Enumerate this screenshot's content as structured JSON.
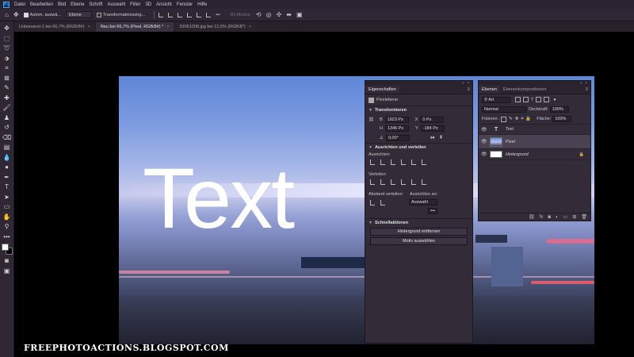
{
  "menu": {
    "logo": "Ps",
    "items": [
      "Datei",
      "Bearbeiten",
      "Bild",
      "Ebene",
      "Schrift",
      "Auswahl",
      "Filter",
      "3D",
      "Ansicht",
      "Fenster",
      "Hilfe"
    ]
  },
  "options": {
    "auto_select_label": "Autom. auswä...",
    "auto_select_value": "Ebene",
    "transform_label": "Transformationsstrg...",
    "mode_3d": "3D-Modus:"
  },
  "tabs": [
    {
      "label": "Unbenannt-1 bei 66,7% (RGB/8#)",
      "close": "×",
      "active": false
    },
    {
      "label": "Neu bei 66,7% (Pixel, RGB/8#) *",
      "close": "×",
      "active": true
    },
    {
      "label": "53061008.jpg bei 12,5% (RGB/8*)",
      "close": "×",
      "active": false
    }
  ],
  "canvas": {
    "text": "Text"
  },
  "watermark": "FREEPHOTOACTIONS.BLOGSPOT.COM",
  "properties": {
    "tab": "Eigenschaften",
    "menu_icon": "≡",
    "layer_type": "Pixelebene",
    "transform": {
      "title": "Transformieren",
      "w_label": "B",
      "w_value": "1923 Px",
      "x_label": "X",
      "x_value": "0 Px",
      "h_label": "H",
      "h_value": "1346 Px",
      "y_label": "Y",
      "y_value": "-184 Px",
      "angle_value": "0,00°"
    },
    "align": {
      "title": "Ausrichten und verteilen",
      "align_label": "Ausrichten:",
      "distribute_label": "Verteilen:",
      "spacing_label": "Abstand verteilen:",
      "align_to_label": "Ausrichten an:",
      "align_to_value": "Auswahl",
      "more": "•••"
    },
    "quick": {
      "title": "Schnellaktionen",
      "remove_bg": "Hintergrund entfernen",
      "select_subject": "Motiv auswählen"
    }
  },
  "layers": {
    "tabs": [
      "Ebenen",
      "Ebenenkompositionen"
    ],
    "menu_icon": "≡",
    "filter_kind": "Art",
    "blend_mode": "Normal",
    "opacity_label": "Deckkraft:",
    "opacity_value": "100%",
    "fixieren_label": "Fixieren:",
    "fill_label": "Fläche:",
    "fill_value": "100%",
    "items": [
      {
        "name": "Text",
        "kind": "text",
        "selected": false,
        "locked": false
      },
      {
        "name": "Pixel",
        "kind": "image",
        "selected": true,
        "locked": false
      },
      {
        "name": "Hintergrund",
        "kind": "white",
        "selected": false,
        "locked": true
      }
    ],
    "bottom_icons": [
      "link-icon",
      "fx-icon",
      "mask-icon",
      "adjustment-icon",
      "group-folder-icon",
      "new-layer-icon",
      "trash-icon"
    ]
  }
}
